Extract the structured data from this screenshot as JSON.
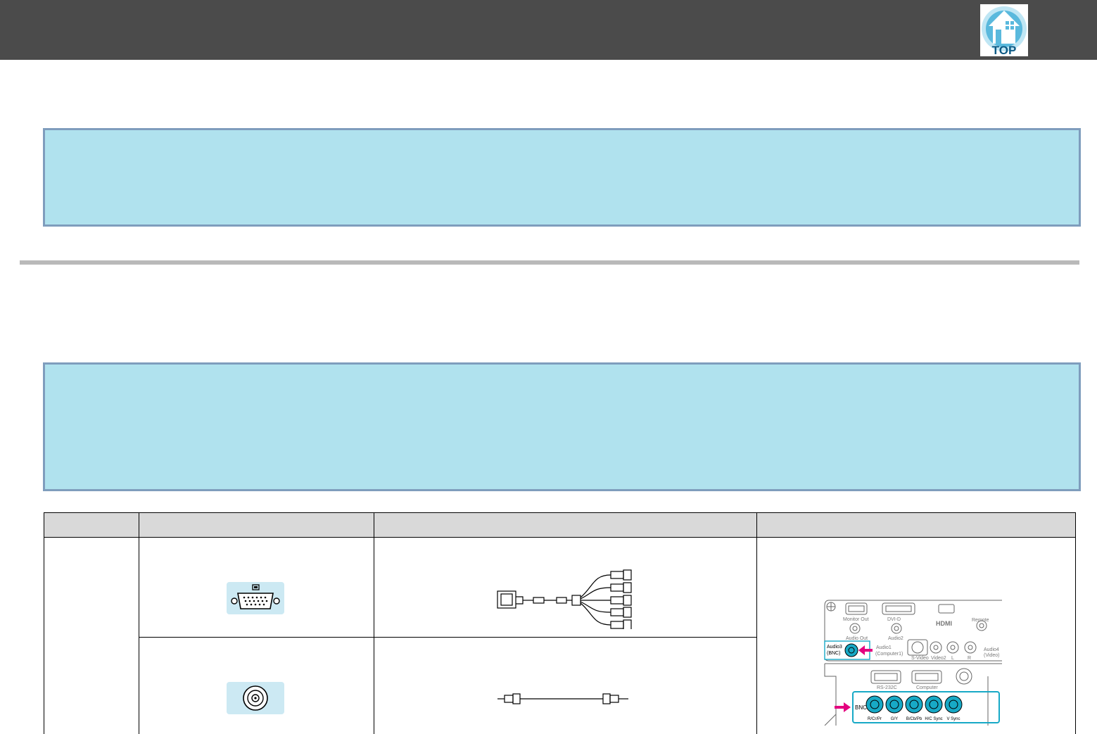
{
  "header": {
    "top_button_label": "TOP",
    "top_button_icon": "home-icon"
  },
  "notes": [
    {
      "icon": "note-icon",
      "text": ""
    },
    {
      "icon": "note-icon",
      "text": ""
    }
  ],
  "table": {
    "column_headers": [
      "",
      "",
      "",
      ""
    ],
    "rows": [
      {
        "port_icon": "computer-port-icon",
        "cable_icon": "vga-to-bnc-cable-icon"
      },
      {
        "port_icon": "bnc-audio-port-icon",
        "cable_icon": "audio-cable-icon"
      }
    ],
    "panel_labels": {
      "monitor_out": "Monitor Out",
      "audio_out": "Audio Out",
      "dvid": "DVI-D",
      "audio2": "Audio2",
      "hdmi": "HDMI",
      "remote": "Remote",
      "audio3": "Audio3",
      "bnc_paren": "(BNC)",
      "audio1": "Audio1",
      "computer1_paren": "(Computer1)",
      "svideo": "S-Video",
      "video2": "Video2",
      "audio4": "Audio4",
      "video_paren": "(Video)",
      "l": "L",
      "r": "R",
      "rs232c": "RS-232C",
      "computer": "Computer",
      "bnc": "BNC",
      "rcrpr": "R/Cr/Pr",
      "gy": "G/Y",
      "bcbpb": "B/Cb/Pb",
      "hcsync": "H/C Sync",
      "vsync": "V Sync"
    }
  },
  "colors": {
    "header": "#4b4b4b",
    "note_fill": "#b0e2ee",
    "note_border": "#7f9dbd",
    "table_header": "#d9d9d9",
    "port_tile": "#cce9f3",
    "highlight": "#17a9c6",
    "arrow": "#e4007f"
  }
}
